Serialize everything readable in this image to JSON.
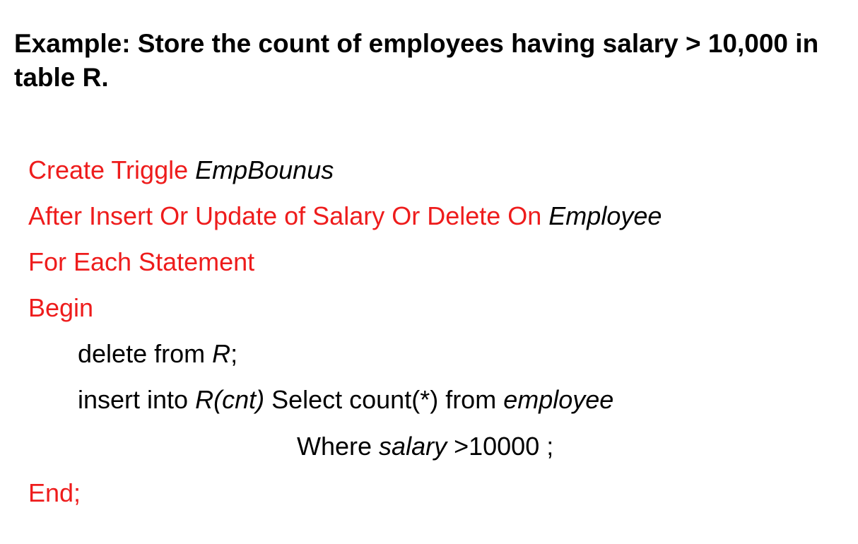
{
  "heading": "Example: Store the count of employees having salary > 10,000 in table R.",
  "colors": {
    "keyword": "#ee1c1c",
    "text": "#000000"
  },
  "code": {
    "line1": {
      "keyword": "Create Triggle ",
      "name": "EmpBounus"
    },
    "line2": {
      "keyword": "After Insert Or Update of Salary Or Delete On ",
      "table": "Employee"
    },
    "line3": {
      "keyword": "For Each Statement"
    },
    "line4": {
      "keyword": "Begin"
    },
    "line5": {
      "text1": "delete from ",
      "table": "R",
      "text2": ";"
    },
    "line6": {
      "text1": "insert into ",
      "target": "R(cnt)",
      "text2": " Select count(*) from ",
      "table": "employee"
    },
    "line7": {
      "text1": "Where ",
      "column": "salary",
      "text2": " >10000",
      "text3": " ;"
    },
    "line8": {
      "keyword": "End;"
    }
  }
}
